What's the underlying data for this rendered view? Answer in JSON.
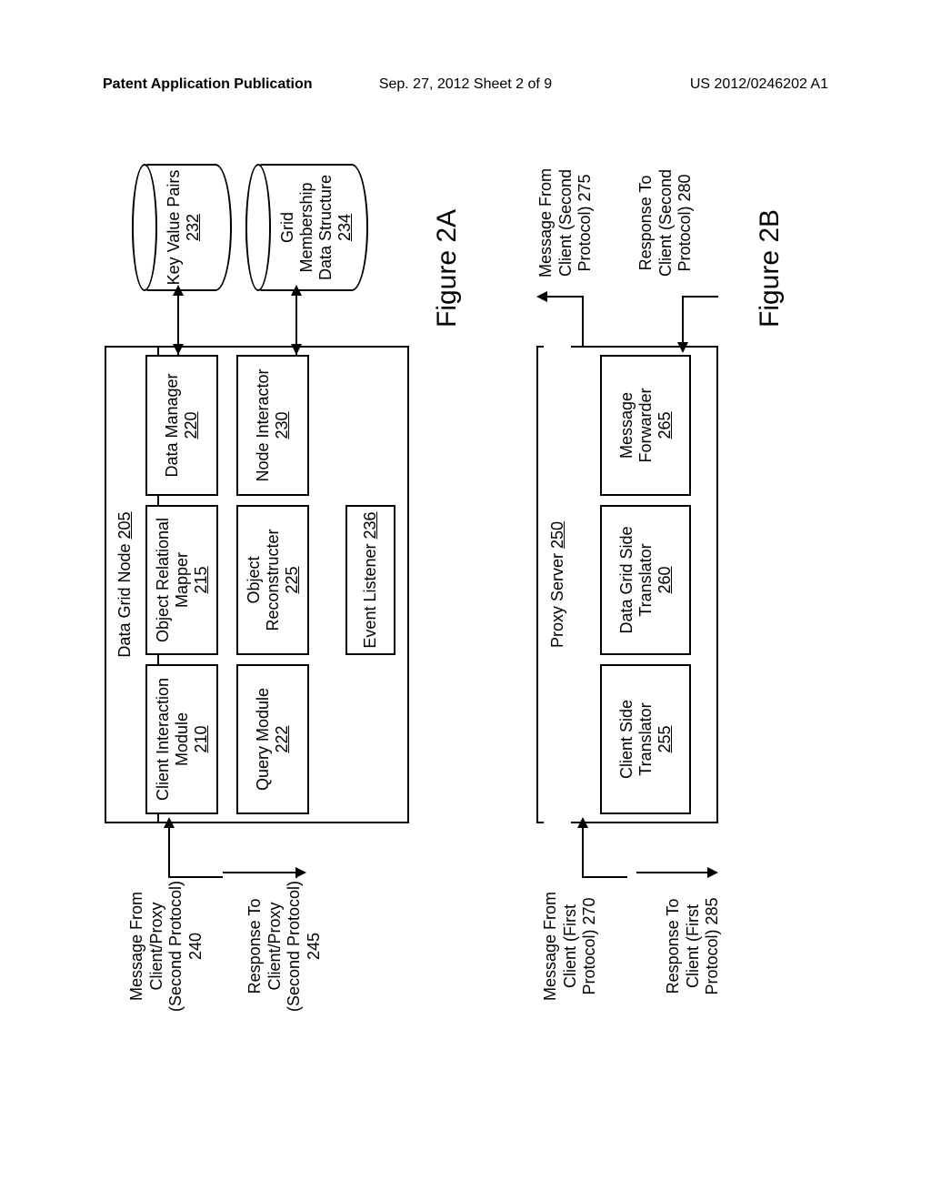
{
  "header": {
    "left": "Patent Application Publication",
    "center": "Sep. 27, 2012  Sheet 2 of 9",
    "right": "US 2012/0246202 A1"
  },
  "figA": {
    "title": "Figure 2A",
    "node": {
      "label": "Data Grid Node",
      "ref": "205"
    },
    "boxes": {
      "client_interaction": {
        "label": "Client Interaction Module",
        "ref": "210"
      },
      "orm": {
        "label": "Object Relational Mapper",
        "ref": "215"
      },
      "data_manager": {
        "label": "Data Manager",
        "ref": "220"
      },
      "query": {
        "label": "Query Module",
        "ref": "222"
      },
      "object_recon": {
        "label": "Object Reconstructer",
        "ref": "225"
      },
      "node_interactor": {
        "label": "Node Interactor",
        "ref": "230"
      },
      "event_listener": {
        "label": "Event Listener",
        "ref": "236"
      }
    },
    "storage": {
      "kv": {
        "label": "Key Value Pairs",
        "ref": "232"
      },
      "grid": {
        "label": "Grid Membership Data Structure",
        "ref": "234"
      }
    },
    "msgs": {
      "msg_in": "Message From Client/Proxy (Second Protocol)  240",
      "resp_out": "Response To Client/Proxy (Second Protocol)  245"
    }
  },
  "figB": {
    "title": "Figure 2B",
    "proxy": {
      "label": "Proxy Server",
      "ref": "250"
    },
    "boxes": {
      "client_trans": {
        "label": "Client Side Translator",
        "ref": "255"
      },
      "grid_trans": {
        "label": "Data Grid Side Translator",
        "ref": "260"
      },
      "msg_fwd": {
        "label": "Message Forwarder",
        "ref": "265"
      }
    },
    "msgs": {
      "left_in": "Message From Client (First Protocol)  270",
      "left_out": "Response To Client (First Protocol)  285",
      "right_out": "Message From Client (Second Protocol)  275",
      "right_in": "Response To Client (Second Protocol)  280"
    }
  }
}
